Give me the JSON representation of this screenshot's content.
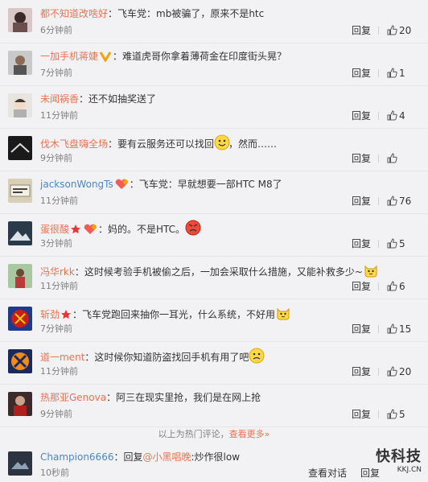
{
  "comments": [
    {
      "name": "都不知道改啥好",
      "text": "：飞车党：mb被骗了，原来不是htc",
      "time": "6分钟前",
      "reply": "回复",
      "likes": "20"
    },
    {
      "name": "一加手机蒋婕",
      "text": "：难道虎哥你拿着薄荷金在印度街头晃？",
      "time": "7分钟前",
      "reply": "回复",
      "likes": "1"
    },
    {
      "name": "未闻祸香",
      "text": "：还不如抽奖送了",
      "time": "11分钟前",
      "reply": "回复",
      "likes": "4"
    },
    {
      "name": "伐木飞盘嗨全场",
      "text_a": "：要有云服务还可以找回",
      "text_b": "，然而……",
      "time": "9分钟前",
      "reply": "回复",
      "likes": ""
    },
    {
      "name": "jacksonWongTs",
      "text": "：飞车党：早就想要一部HTC M8了",
      "time": "11分钟前",
      "reply": "回复",
      "likes": "76"
    },
    {
      "name": "蛋很酸",
      "text": "：妈的。不是HTC。",
      "time": "3分钟前",
      "reply": "回复",
      "likes": "5"
    },
    {
      "name": "冯华rkk",
      "text": "：这时候考验手机被偷之后，一加会采取什么措施，又能补救多少~",
      "time": "11分钟前",
      "reply": "回复",
      "likes": "6"
    },
    {
      "name": "斩劲",
      "text": "：飞车党跑回来抽你一耳光，什么系统，不好用",
      "time": "7分钟前",
      "reply": "回复",
      "likes": "15"
    },
    {
      "name": "道一ment",
      "text": "：这时候你知道防盗找回手机有用了吧",
      "time": "11分钟前",
      "reply": "回复",
      "likes": "20"
    },
    {
      "name": "热那亚Genova",
      "text": "：阿三在现实里抢，我们是在网上抢",
      "time": "9分钟前",
      "reply": "回复",
      "likes": "5"
    }
  ],
  "hot_tip": {
    "text": "以上为热门评论，",
    "more": "查看更多»"
  },
  "last": {
    "name": "Champion6666",
    "text_a": "：回复",
    "mention": "@小黑唱晚",
    "text_b": ":炒作很low",
    "time": "10秒前",
    "view": "查看对话",
    "reply": "回复"
  },
  "watermark": {
    "title": "快科技",
    "url": "KKJ.CN"
  }
}
